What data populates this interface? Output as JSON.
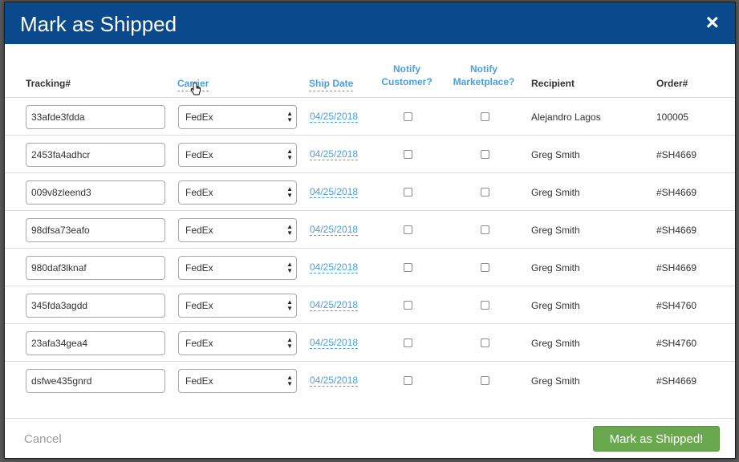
{
  "modal": {
    "title": "Mark as Shipped",
    "close_icon": "×"
  },
  "columns": {
    "tracking": "Tracking#",
    "carrier": "Carrier",
    "ship_date": "Ship Date",
    "notify_customer_line1": "Notify",
    "notify_customer_line2": "Customer?",
    "notify_marketplace_line1": "Notify",
    "notify_marketplace_line2": "Marketplace?",
    "recipient": "Recipient",
    "order": "Order#"
  },
  "rows": [
    {
      "tracking": "33afde3fdda",
      "carrier": "FedEx",
      "ship_date": "04/25/2018",
      "notify_customer": false,
      "notify_marketplace": false,
      "recipient": "Alejandro Lagos",
      "order": "100005"
    },
    {
      "tracking": "2453fa4adhcr",
      "carrier": "FedEx",
      "ship_date": "04/25/2018",
      "notify_customer": false,
      "notify_marketplace": false,
      "recipient": "Greg Smith",
      "order": "#SH4669"
    },
    {
      "tracking": "009v8zleend3",
      "carrier": "FedEx",
      "ship_date": "04/25/2018",
      "notify_customer": false,
      "notify_marketplace": false,
      "recipient": "Greg Smith",
      "order": "#SH4669"
    },
    {
      "tracking": "98dfsa73eafo",
      "carrier": "FedEx",
      "ship_date": "04/25/2018",
      "notify_customer": false,
      "notify_marketplace": false,
      "recipient": "Greg Smith",
      "order": "#SH4669"
    },
    {
      "tracking": "980daf3lknaf",
      "carrier": "FedEx",
      "ship_date": "04/25/2018",
      "notify_customer": false,
      "notify_marketplace": false,
      "recipient": "Greg Smith",
      "order": "#SH4669"
    },
    {
      "tracking": "345fda3agdd",
      "carrier": "FedEx",
      "ship_date": "04/25/2018",
      "notify_customer": false,
      "notify_marketplace": false,
      "recipient": "Greg Smith",
      "order": "#SH4760"
    },
    {
      "tracking": "23afa34gea4",
      "carrier": "FedEx",
      "ship_date": "04/25/2018",
      "notify_customer": false,
      "notify_marketplace": false,
      "recipient": "Greg Smith",
      "order": "#SH4760"
    },
    {
      "tracking": "dsfwe435gnrd",
      "carrier": "FedEx",
      "ship_date": "04/25/2018",
      "notify_customer": false,
      "notify_marketplace": false,
      "recipient": "Greg Smith",
      "order": "#SH4669"
    }
  ],
  "footer": {
    "cancel_label": "Cancel",
    "submit_label": "Mark as Shipped!"
  },
  "colors": {
    "header_bg": "#0a4a8c",
    "link": "#4a9fe0",
    "submit_bg": "#6aa84f"
  },
  "icons": {
    "close": "close-icon",
    "select_arrows": "updown-arrows-icon",
    "cursor": "hand-pointer-icon"
  }
}
